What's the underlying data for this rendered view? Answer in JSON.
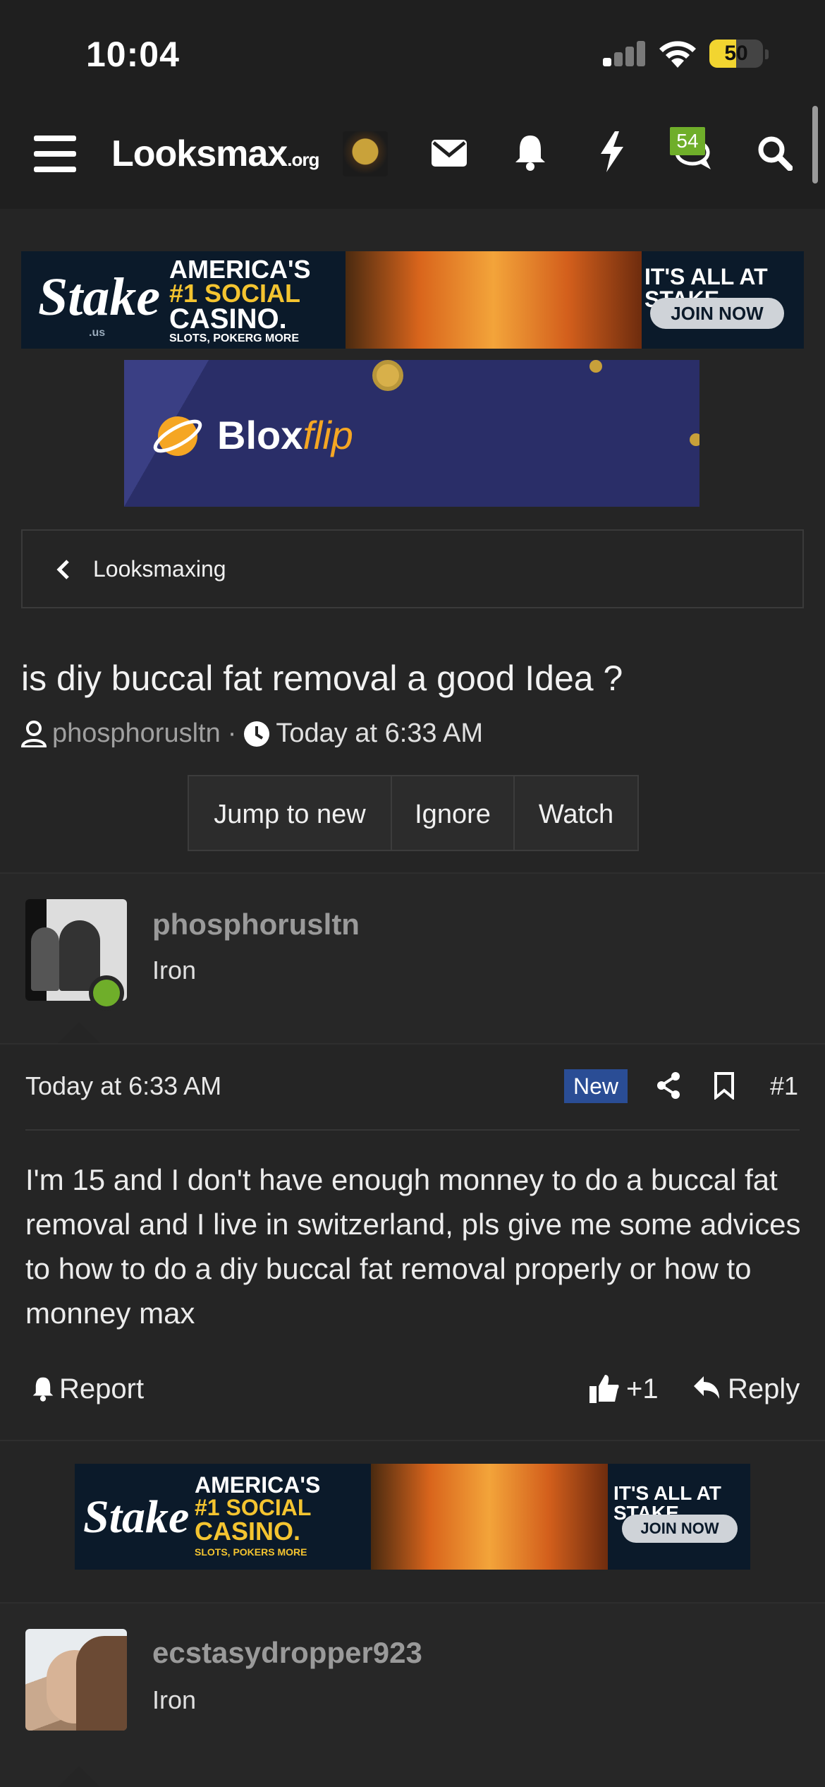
{
  "status_bar": {
    "time": "10:04",
    "battery_level": "50",
    "battery_fraction": 0.5
  },
  "nav": {
    "logo_main": "Looksmax",
    "logo_suffix": ".org",
    "chat_badge": "54",
    "icons": [
      "menu-icon",
      "mail-icon",
      "bell-icon",
      "lightning-icon",
      "chat-icon",
      "search-icon"
    ]
  },
  "ads": {
    "stake_top": {
      "brand": "Stake",
      "brand_suffix": ".us",
      "line1": "AMERICA'S",
      "line2": "#1 SOCIAL",
      "line3": "CASINO.",
      "line4": "SLOTS, POKERG MORE",
      "tagline": "IT'S ALL AT STAKE",
      "cta": "JOIN NOW"
    },
    "bloxflip": {
      "brand_main": "Blox",
      "brand_italic": "flip"
    },
    "stake_bottom": {
      "brand": "Stake",
      "line1": "AMERICA'S",
      "line2": "#1 SOCIAL",
      "line3": "CASINO.",
      "line4": "SLOTS, POKERS MORE",
      "tagline": "IT'S ALL AT STAKE",
      "cta": "JOIN NOW"
    }
  },
  "breadcrumb": {
    "label": "Looksmaxing"
  },
  "thread": {
    "title": "is diy buccal fat removal a good Idea ?",
    "author": "phosphorusltn",
    "separator": "·",
    "time": "Today at 6:33 AM",
    "actions": [
      "Jump to new",
      "Ignore",
      "Watch"
    ]
  },
  "post1": {
    "username": "phosphorusltn",
    "rank": "Iron",
    "date": "Today at 6:33 AM",
    "new_label": "New",
    "post_number": "#1",
    "body": "I'm 15 and I don't have enough monney to do a buccal fat removal and I live in switzerland, pls give me some advices to how to do a diy buccal fat removal properly or how to monney max",
    "report_label": "Report",
    "reaction_count": "+1",
    "reply_label": "Reply"
  },
  "post2": {
    "username": "ecstasydropper923",
    "rank": "Iron"
  },
  "colors": {
    "background": "#252525",
    "header": "#1f1f1f",
    "online_dot": "#6fae2a",
    "new_badge": "#2a4d95",
    "battery": "#f2d530"
  }
}
